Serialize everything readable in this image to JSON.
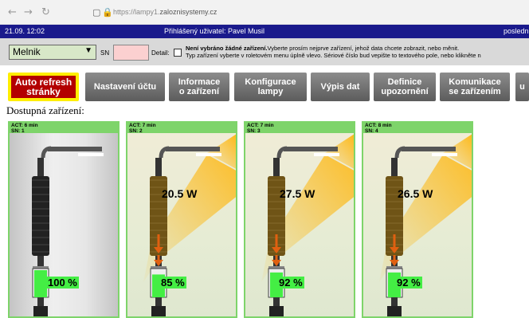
{
  "browser": {
    "url_prefix": "https://lampy1.",
    "url_domain": "zaloznisystemy.cz"
  },
  "topbar": {
    "datetime": "21.09. 12:02",
    "user": "Přihlášený uživatel: Pavel Musil",
    "right": "posledni"
  },
  "controls": {
    "location_select": "Melnik",
    "sn_label": "SN",
    "sn_value": "",
    "detail_label": "Detail:",
    "message_bold": "Není vybráno žádné zařízení.",
    "message_line1": "Vyberte prosím nejprve zařízení, jehož data chcete zobrazit, nebo měnit.",
    "message_line2": "Typ zařízení vyberte v roletovém menu úplně vlevo. Sériové číslo bud vepište to textového pole, nebo klikněte n"
  },
  "menu": [
    {
      "line1": "Auto refresh",
      "line2": "stránky"
    },
    {
      "line1": "Nastavení účtu",
      "line2": ""
    },
    {
      "line1": "Informace",
      "line2": "o zařízení"
    },
    {
      "line1": "Konfigurace",
      "line2": "lampy"
    },
    {
      "line1": "Výpis dat",
      "line2": ""
    },
    {
      "line1": "Definice",
      "line2": "upozornění"
    },
    {
      "line1": "Komunikace",
      "line2": "se zařízením"
    },
    {
      "line1": "u",
      "line2": ""
    }
  ],
  "section_title": "Dostupná zařízení:",
  "devices": [
    {
      "act": "ACT: 6 min",
      "sn": "SN: 1",
      "power": "",
      "battery": "100 %",
      "battery_level": 1.0,
      "lit": false
    },
    {
      "act": "ACT: 7 min",
      "sn": "SN: 2",
      "power": "20.5 W",
      "battery": "85 %",
      "battery_level": 0.85,
      "lit": true
    },
    {
      "act": "ACT: 7 min",
      "sn": "SN: 3",
      "power": "27.5 W",
      "battery": "92 %",
      "battery_level": 0.92,
      "lit": true
    },
    {
      "act": "ACT: 8 min",
      "sn": "SN: 4",
      "power": "26.5 W",
      "battery": "92 %",
      "battery_level": 0.92,
      "lit": true
    }
  ],
  "colors": {
    "topbar": "#1a1a8c",
    "active_button": "#b30000",
    "active_border": "#ffee00",
    "card_header": "#7ed46a",
    "battery_green": "#44ee44",
    "light_beam": "#ffb300"
  }
}
